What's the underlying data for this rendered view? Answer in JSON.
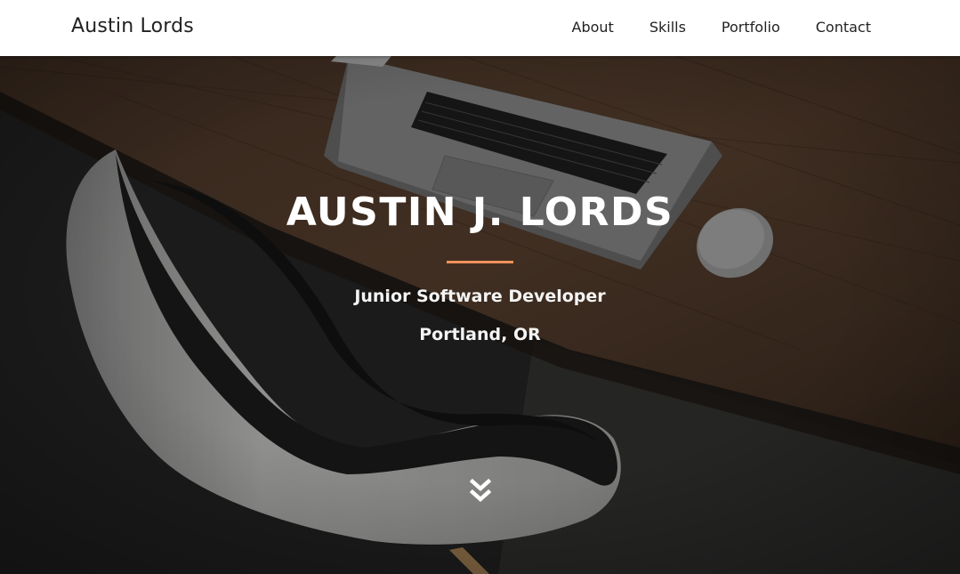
{
  "navbar": {
    "brand": "Austin Lords",
    "links": [
      {
        "label": "About"
      },
      {
        "label": "Skills"
      },
      {
        "label": "Portfolio"
      },
      {
        "label": "Contact"
      }
    ]
  },
  "hero": {
    "title": "AUSTIN J. LORDS",
    "subtitle": "Junior Software Developer",
    "location": "Portland, OR",
    "scroll_icon": "double-chevron-down-icon"
  },
  "colors": {
    "accent": "#f0915b",
    "navbar_bg": "#ffffff",
    "hero_text": "#ffffff"
  }
}
